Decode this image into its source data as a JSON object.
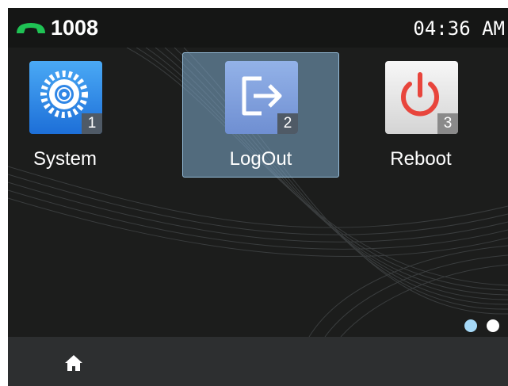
{
  "status_bar": {
    "line_icon": "phone-handset-icon",
    "extension": "1008",
    "time": "04:36 AM"
  },
  "apps": [
    {
      "label": "System",
      "icon": "gear-icon",
      "badge": "1",
      "selected": false
    },
    {
      "label": "LogOut",
      "icon": "logout-icon",
      "badge": "2",
      "selected": true
    },
    {
      "label": "Reboot",
      "icon": "power-icon",
      "badge": "3",
      "selected": false
    }
  ],
  "pager": {
    "page_count": 2,
    "current_page": 1
  },
  "nav_bar": {
    "home_icon": "home-icon"
  },
  "colors": {
    "screen_bg": "#1c1d1c",
    "status_bar_bg": "#151615",
    "nav_bar_bg": "#2d2f30",
    "selection": "#7aa3c4",
    "phone_icon": "#1fc254",
    "active_dot": "#a6d9f7"
  }
}
